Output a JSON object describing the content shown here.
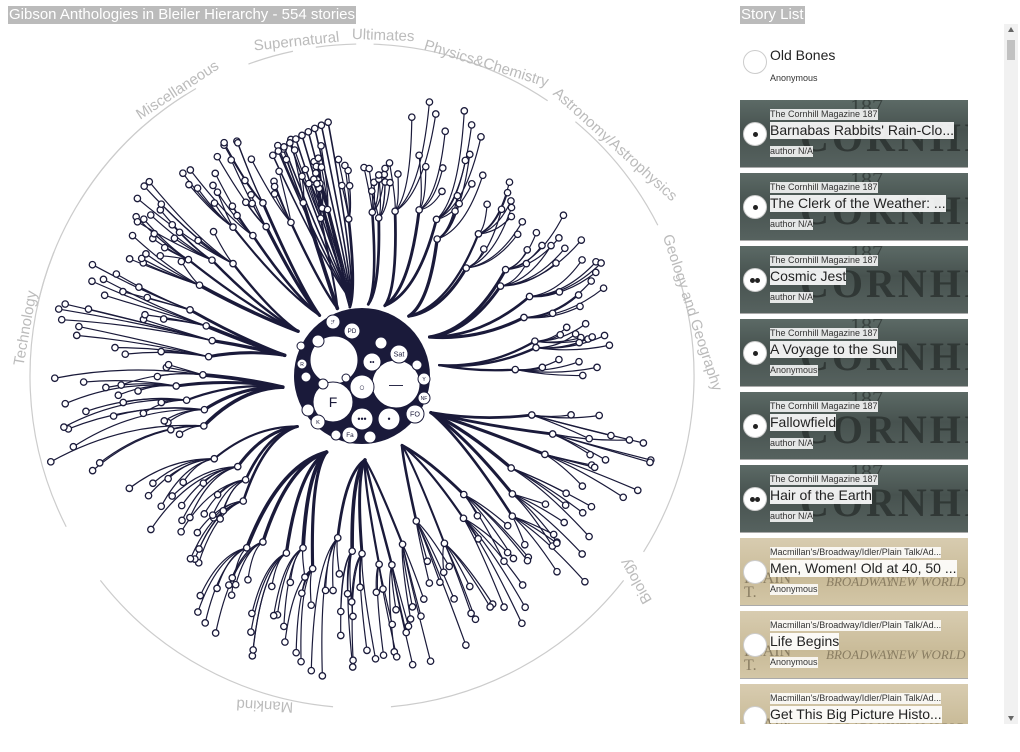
{
  "title": "Gibson Anthologies in Bleiler Hierarchy - 554 stories",
  "list_title": "Story List",
  "categories": [
    "Supernatural",
    "Ultimates",
    "Physics&Chemistry",
    "Astronomy/Astrophysics",
    "Geology and Geography",
    "Biology",
    "Mankind",
    "Technology",
    "Miscellaneous"
  ],
  "hub_labels": [
    "F",
    "FO",
    "Sat",
    "NF",
    "PD",
    "Y",
    "R",
    "K",
    "Fa"
  ],
  "stories": [
    {
      "title": "Old Bones",
      "author": "Anonymous",
      "magazine": "",
      "style": "plain",
      "dots": 0
    },
    {
      "title": "Barnabas Rabbits' Rain-Clo...",
      "author": "author N/A",
      "magazine": "The Cornhill Magazine 187",
      "style": "cornhill",
      "dots": 1
    },
    {
      "title": "The Clerk of the Weather: ...",
      "author": "author N/A",
      "magazine": "The Cornhill Magazine 187",
      "style": "cornhill",
      "dots": 1
    },
    {
      "title": "Cosmic Jest",
      "author": "author N/A",
      "magazine": "The Cornhill Magazine 187",
      "style": "cornhill",
      "dots": 2
    },
    {
      "title": "A Voyage to the Sun",
      "author": "Anonymous",
      "magazine": "The Cornhill Magazine 187",
      "style": "cornhill",
      "dots": 1
    },
    {
      "title": "Fallowfield",
      "author": "author N/A",
      "magazine": "The Cornhill Magazine 187",
      "style": "cornhill",
      "dots": 1
    },
    {
      "title": "Hair of the Earth",
      "author": "author N/A",
      "magazine": "The Cornhill Magazine 187",
      "style": "cornhill",
      "dots": 2
    },
    {
      "title": "Men, Women! Old at 40, 50 ...",
      "author": "Anonymous",
      "magazine": "Macmillan's/Broadway/Idler/Plain Talk/Ad...",
      "style": "macm",
      "dots": 0
    },
    {
      "title": "Life Begins",
      "author": "Anonymous",
      "magazine": "Macmillan's/Broadway/Idler/Plain Talk/Ad...",
      "style": "macm",
      "dots": 0
    },
    {
      "title": "Get This Big Picture Histo...",
      "author": "",
      "magazine": "Macmillan's/Broadway/Idler/Plain Talk/Ad...",
      "style": "macm",
      "dots": 0
    }
  ],
  "colors": {
    "tree": "#1a1a3a",
    "arc": "#cccccc",
    "label": "#bbbbbb"
  }
}
